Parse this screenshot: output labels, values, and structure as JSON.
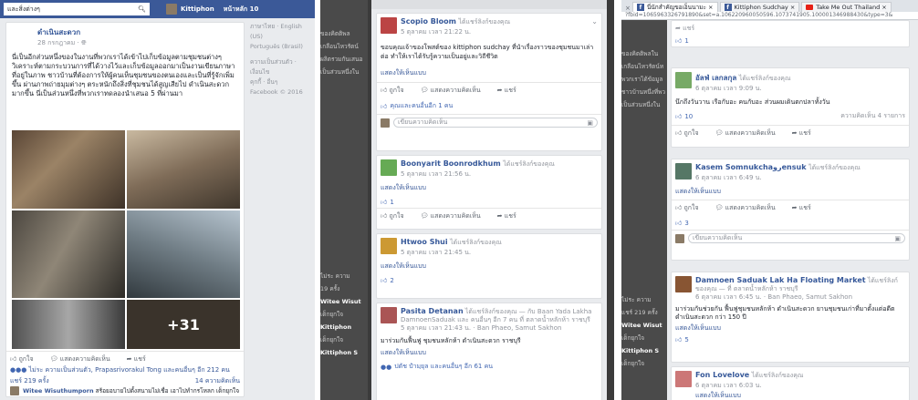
{
  "panel1": {
    "search_placeholder": "และสิ่งต่างๆ",
    "profile_name": "Kittiphon",
    "home_label": "หน้าหลัก 10",
    "page_name": "ดำเนินสะดวก",
    "post_date": "28 กรกฎาคม · ",
    "post_text": "นี่เป็นอีกส่วนหนึ่งของในงานที่พวกเราได้เข้าไปเก็บข้อมูลตามชุมชนต่างๆ วิเคราะห์ตามกระบวนการที่ได้วางไว้และเก็บข้อมูลออกมาเป็นงานเขียนภาษาที่อยู่ในภาพ ชาวบ้านที่ต้องการให้ผู้คนเห็นชุมชนของตนเองและเป็นที่รู้จักเพิ่มขึ้น ผ่านภาพถ่ายมุมต่างๆ ตระหนักถึงสิ่งที่ชุมชนได้สูญเสียไป ดำเนินสะดวกมากขึ้น นี่เป็นส่วนหนึ่งที่พวกเราทดลองนำเสนอ 5 ที่ผ่านมา",
    "right_col": [
      "ภาษาไทย · English (US)",
      "Português (Brasil)",
      "ความเป็นส่วนตัว · เงื่อนไข",
      "คุกกี้ · อื่นๆ",
      "Facebook © 2016"
    ],
    "photo_more": "+31",
    "like": "ถูกใจ",
    "comment": "แสดงความคิดเห็น",
    "share": "แชร์",
    "reactions_text": "ไม่ระ ความเป็นส่วนตัว, Prapasrivorakul Tong และคนอื่นๆ อีก 212 คน",
    "shares_count": "แชร์ 219 ครั้ง",
    "comments_count": "14 ความคิดเห็น",
    "comment_author": "Witee Wisuthumporn",
    "comment_text": "สร้อยอบายไปตั้งสนามไม่เชื่อ เอาไปทำกรโหลก เด็กยุกใจ · ตอบกลับ · 1 · 3 สิงหาคม เวลา 17:50 น."
  },
  "panel2": {
    "posts": [
      {
        "name": "Scopio Bloom",
        "sub": "ได้แชร์ลิงก์ของคุณ",
        "date": "5 ตุลาคม เวลา 21:22 น.",
        "text": "ขอบคุณเจ้าของโพสต์ของ kittiphon sudchay ที่นำเรื่องราวของชุมชนมาเล่าต่อ ทำให้เราได้รับรู้ความเป็นอยู่และวิถีชีวิต",
        "show": "แสดงให้เห็นแบบ",
        "liked": "คุณและคนอื่นอีก 1 คน",
        "cb": "เขียนความคิดเห็น"
      },
      {
        "name": "Boonyarit Boonrodkhum",
        "sub": "ได้แชร์ลิงก์ของคุณ",
        "date": "5 ตุลาคม เวลา 21:56 น.",
        "show": "แสดงให้เห็นแบบ",
        "n": "1"
      },
      {
        "name": "Htwoo Shui",
        "sub": "ได้แชร์ลิงก์ของคุณ",
        "date": "5 ตุลาคม เวลา 21:45 น.",
        "show": "แสดงให้เห็นแบบ",
        "n": "2"
      },
      {
        "name": "Pasita Detanan",
        "sub": "ได้แชร์ลิงก์ของคุณ — กับ Baan Yada Lakha DamnoenSaduak และ คนอื่นๆ อีก 7 คน ที่ ตลาดน้ำหลักห้า ราชบุรี",
        "date": "5 ตุลาคม เวลา 21:43 น. · Ban Phaeo, Samut Sakhon",
        "text": "มาร่วมกันฟื้นฟู ชุมชนหลักห้า ดำเนินสะดวก ราชบุรี",
        "show": "แสดงให้เห็นแบบ",
        "liked": "ปตัช ปำมฺยุล และคนอื่นๆ อีก 61 คน"
      }
    ],
    "left_peek": [
      "ของคิตติพล",
      "เกลือนไหวรัตน์",
      "ผลิตรวมกันเสนอ",
      "เป็นส่วนหนึ่งใน",
      "ไม่ระ ความ",
      "19 ครั้ง",
      "Witee Wisut",
      "เด็กยุกใจ",
      "Kittiphon",
      "เด็กยุกใจ",
      "Kittiphon S"
    ]
  },
  "panel3": {
    "tabs": [
      "นี่นักสำคัญขอเอ็นนามะ ×",
      "Kittiphon Sudchay ×",
      "Take Me Out Thailand ×"
    ],
    "url": "?fbid=1065963326791890&set=a.106220960050596.1073741905.100001346988430&type=3&",
    "top_share": "แชร์",
    "top_count": "1",
    "posts": [
      {
        "name": "อัลฟ่ เลกลกุล",
        "sub": "ได้แชร์ลิงก์ของคุณ",
        "date": "6 ตุลาคม เวลา 9:09 น.",
        "text": "นึกถึงวันวาน เรือกับอะ คนกับอะ ส่วนผมเดินตกปลาทั้งวัน",
        "n": "10",
        "extra": "ความคิดเห็น 4 รายการ"
      },
      {
        "name": "Kasem Somnukchaروensuk",
        "sub": "ได้แชร์ลิงก์ของคุณ",
        "date": "6 ตุลาคม เวลา 6:49 น.",
        "show": "แสดงให้เห็นแบบ",
        "n": "3",
        "cb": "เขียนความคิดเห็น"
      },
      {
        "name": "Damnoen Saduak Lak Ha Floating Market",
        "sub": "ได้แชร์ลิงก์ของคุณ — ที่ ตลาดน้ำหลักห้า ราชบุรี",
        "date": "6 ตุลาคม เวลา 6:45 น. · Ban Phaeo, Samut Sakhon",
        "text": "มาร่วมกันช่วยกัน ฟื้นฟูชุมชนหลักห้า ดำเนินสะดวก ยานชุมชนเก่าที่มาตั้งแต่อดีต ดำเนินสะดวก กว่า 150 ปี",
        "show": "แสดงให้เห็นแบบ",
        "n": "5"
      },
      {
        "name": "Fon Lovelove",
        "sub": "ได้แชร์ลิงก์ของคุณ",
        "date": "6 ตุลาคม เวลา 6:03 น.",
        "show": "แสดงให้เห็นแบบ"
      }
    ],
    "left_peek": [
      "ของคิตติพลใน",
      "เกลือนไหวรัตน์ท",
      "พวกเราได้ข้อมูล",
      "ชาวบ้านหนึ่งที่พว",
      "เป็นส่วนหนึ่งใน",
      "ไม่ระ ความ",
      "แชร์ 219 ครั้ง",
      "Witee Wisut",
      "เด็กยุกใจ",
      "Kittiphon S",
      "เด็กยุกใจ"
    ]
  }
}
